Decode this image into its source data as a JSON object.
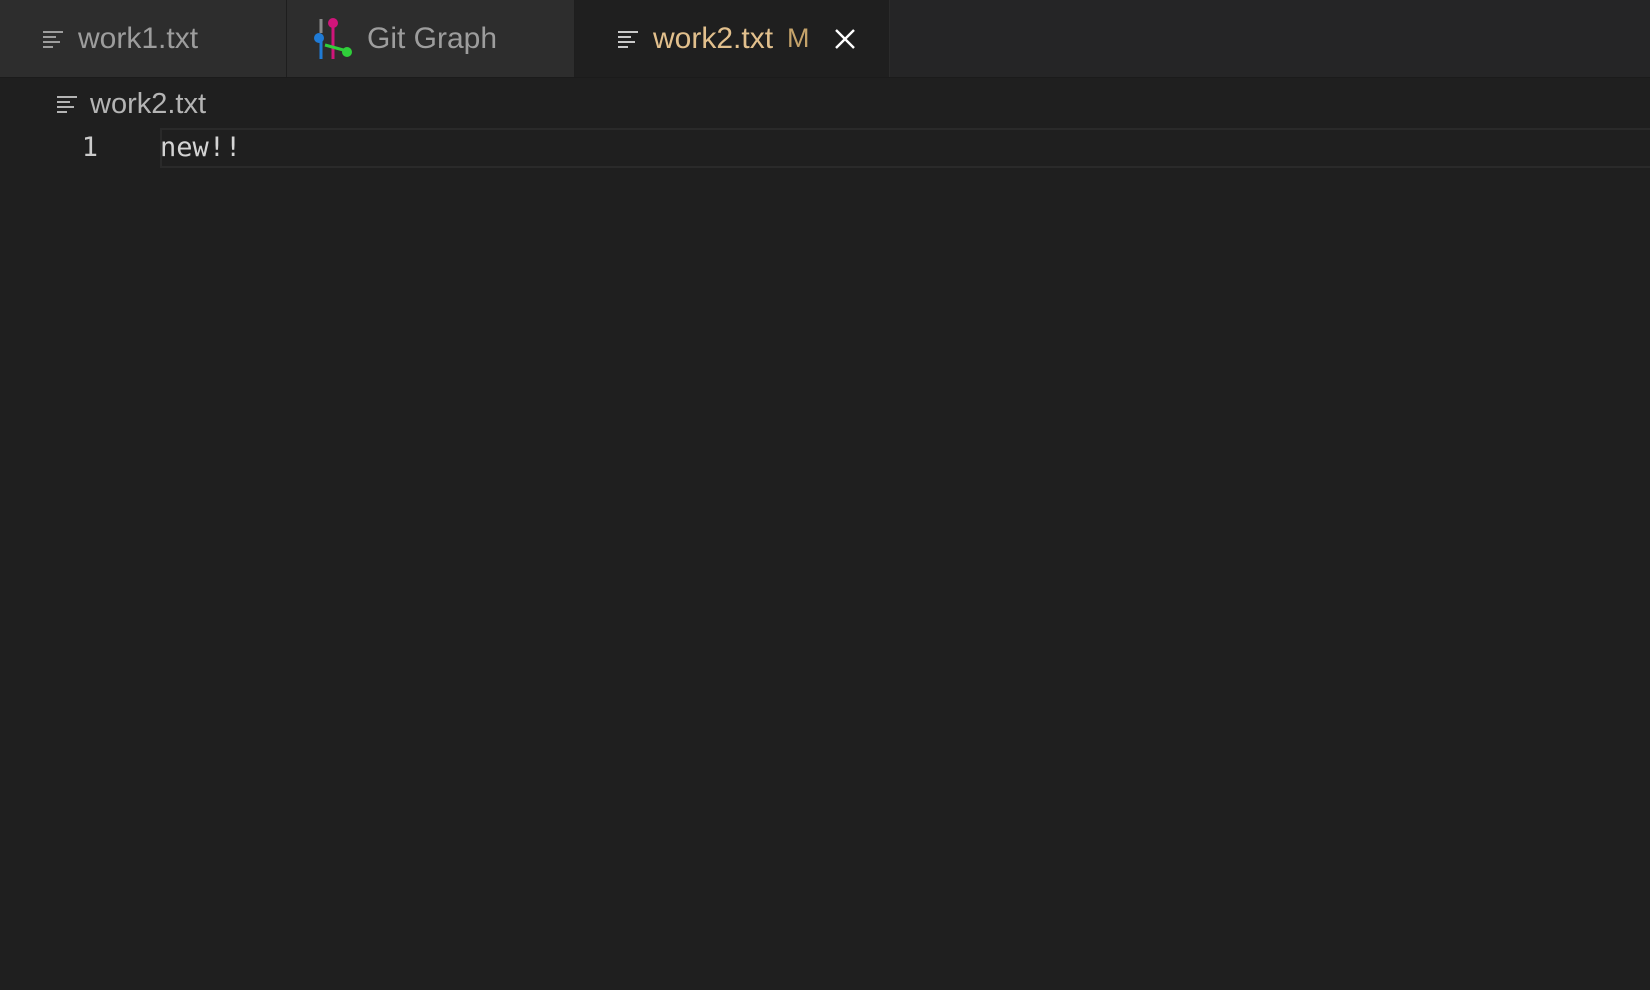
{
  "tabs": [
    {
      "label": "work1.txt",
      "icon": "lines-icon",
      "active": false
    },
    {
      "label": "Git Graph",
      "icon": "git-graph-icon",
      "active": false
    },
    {
      "label": "work2.txt",
      "icon": "lines-icon",
      "active": true,
      "modified_badge": "M"
    }
  ],
  "breadcrumb": {
    "label": "work2.txt",
    "icon": "lines-icon"
  },
  "editor": {
    "lines": [
      {
        "number": "1",
        "text": "new!!"
      }
    ]
  },
  "colors": {
    "background": "#1f1f1f",
    "tabbar": "#252526",
    "inactive_tab": "#2d2d2d",
    "active_tab_label": "#e2c08d",
    "modified_badge": "#c5a36a"
  }
}
